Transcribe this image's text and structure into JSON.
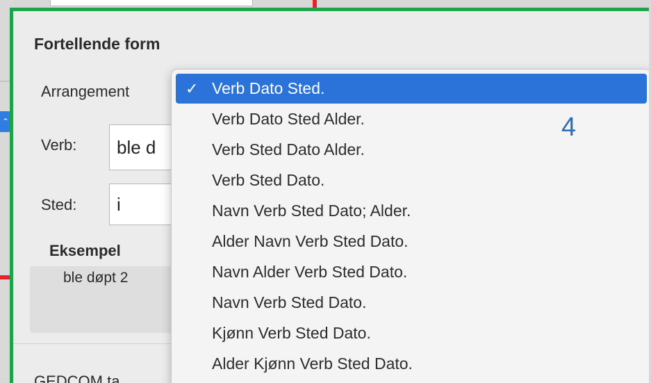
{
  "panel": {
    "section_title": "Fortellende form",
    "arrangement_label": "Arrangement",
    "verb_label": "Verb:",
    "verb_value": "ble d",
    "sted_label": "Sted:",
    "sted_value": "i",
    "example_title": "Eksempel",
    "example_text": "ble døpt 2",
    "gedcom_text": "GEDCOM ta"
  },
  "menu": {
    "items": [
      {
        "label": "Verb Dato Sted.",
        "selected": true
      },
      {
        "label": "Verb Dato Sted Alder.",
        "selected": false
      },
      {
        "label": "Verb Sted Dato Alder.",
        "selected": false
      },
      {
        "label": "Verb Sted Dato.",
        "selected": false
      },
      {
        "label": "Navn Verb Sted Dato; Alder.",
        "selected": false
      },
      {
        "label": "Alder Navn Verb Sted Dato.",
        "selected": false
      },
      {
        "label": "Navn Alder Verb Sted Dato.",
        "selected": false
      },
      {
        "label": "Navn Verb Sted Dato.",
        "selected": false
      },
      {
        "label": "Kjønn Verb Sted Dato.",
        "selected": false
      },
      {
        "label": "Alder Kjønn Verb Sted Dato.",
        "selected": false
      }
    ],
    "check_glyph": "✓"
  },
  "annotation": {
    "text": "4",
    "color": "#2e6fb7"
  },
  "colors": {
    "frame": "#1fa34a",
    "highlight": "#2b73d9",
    "red_marker": "#e8242a"
  }
}
